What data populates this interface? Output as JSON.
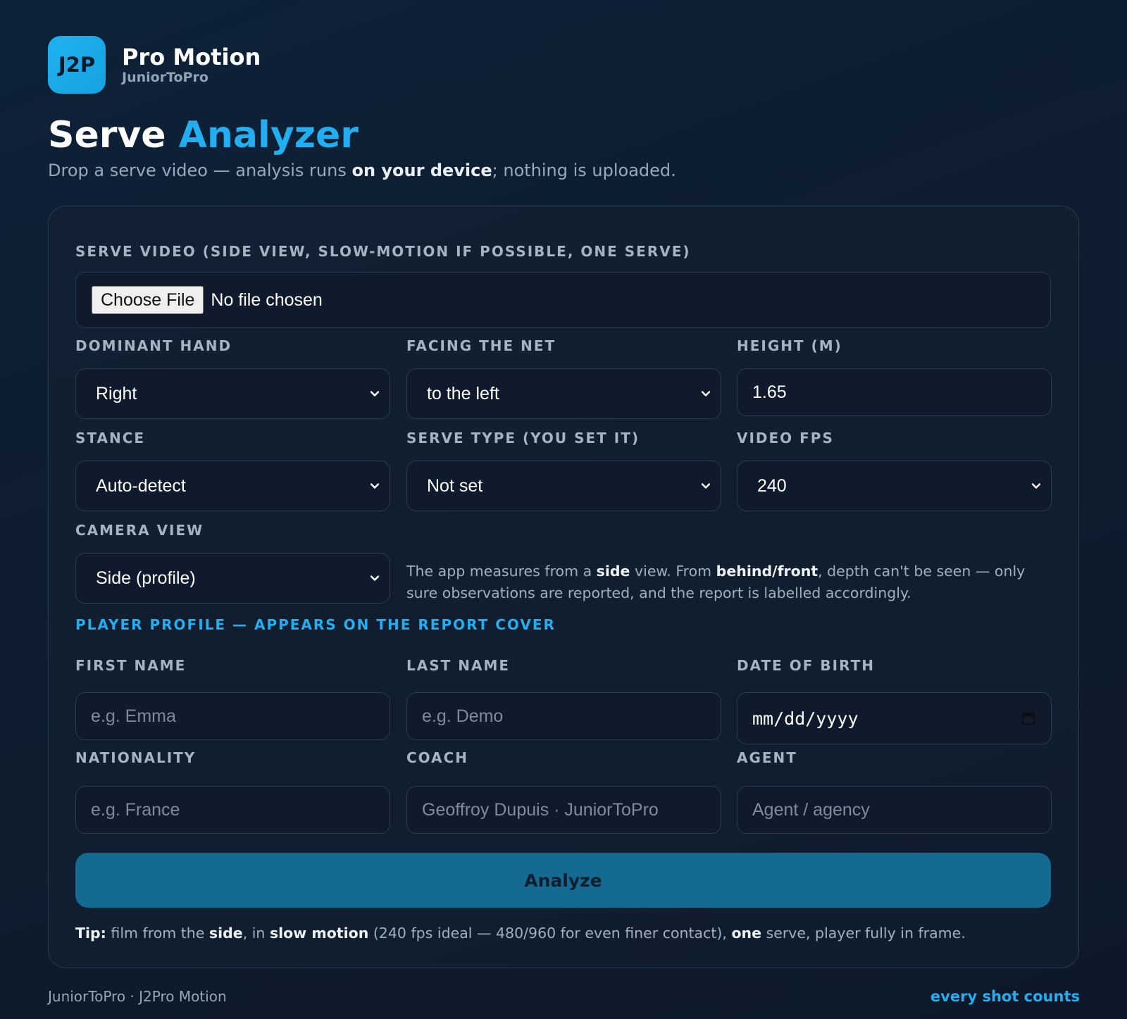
{
  "brand": {
    "logo_text": "J2P",
    "name": "Pro Motion",
    "sub": "JuniorToPro"
  },
  "header": {
    "title_main": "Serve",
    "title_accent": "Analyzer",
    "subtitle_pre": "Drop a serve video — analysis runs ",
    "subtitle_bold": "on your device",
    "subtitle_post": "; nothing is uploaded."
  },
  "form": {
    "video_label": "Serve video (side view, slow-motion if possible, one serve)",
    "choose_file_label": "Choose File",
    "no_file_text": "No file chosen",
    "dominant_hand": {
      "label": "Dominant hand",
      "value": "Right"
    },
    "facing_net": {
      "label": "Facing the net",
      "value": "to the left"
    },
    "height": {
      "label": "Height (m)",
      "value": "1.65"
    },
    "stance": {
      "label": "Stance",
      "value": "Auto-detect"
    },
    "serve_type": {
      "label": "Serve type (you set it)",
      "value": "Not set"
    },
    "video_fps": {
      "label": "Video FPS",
      "value": "240"
    },
    "camera_view": {
      "label": "Camera view",
      "value": "Side (profile)"
    },
    "camera_note": {
      "t1": "The app measures from a ",
      "b1": "side",
      "t2": " view. From ",
      "b2": "behind/front",
      "t3": ", depth can't be seen — only sure observations are reported, and the report is labelled accordingly."
    },
    "profile_heading": "Player profile — appears on the report cover",
    "first_name": {
      "label": "First name",
      "placeholder": "e.g. Emma"
    },
    "last_name": {
      "label": "Last name",
      "placeholder": "e.g. Demo"
    },
    "dob": {
      "label": "Date of birth",
      "placeholder": "mm/dd/yyyy"
    },
    "nationality": {
      "label": "Nationality",
      "placeholder": "e.g. France"
    },
    "coach": {
      "label": "Coach",
      "placeholder": "Geoffroy Dupuis · JuniorToPro"
    },
    "agent": {
      "label": "Agent",
      "placeholder": "Agent / agency"
    },
    "analyze_label": "Analyze",
    "tip": {
      "b0": "Tip:",
      "t1": " film from the ",
      "b1": "side",
      "t2": ", in ",
      "b2": "slow motion",
      "t3": " (240 fps ideal — 480/960 for even finer contact), ",
      "b3": "one",
      "t4": " serve, player fully in frame."
    }
  },
  "footer": {
    "left": "JuniorToPro · J2Pro Motion",
    "right": "every shot counts"
  },
  "colors": {
    "accent": "#22aef0",
    "button": "#156a91",
    "background": "#0f1d30"
  }
}
